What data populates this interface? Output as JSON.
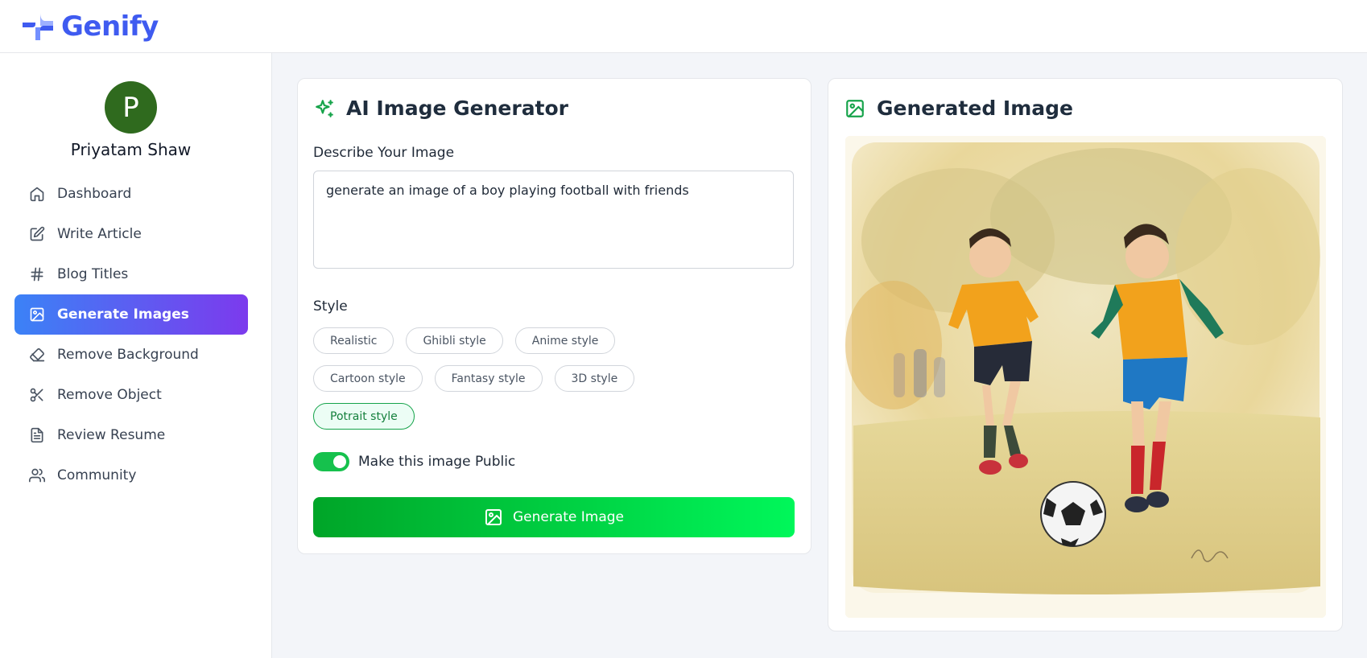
{
  "app": {
    "name": "Genify"
  },
  "user": {
    "initial": "P",
    "name": "Priyatam Shaw"
  },
  "sidebar": {
    "items": [
      {
        "label": "Dashboard",
        "icon": "home-icon",
        "active": false
      },
      {
        "label": "Write Article",
        "icon": "edit-icon",
        "active": false
      },
      {
        "label": "Blog Titles",
        "icon": "hash-icon",
        "active": false
      },
      {
        "label": "Generate Images",
        "icon": "image-icon",
        "active": true
      },
      {
        "label": "Remove Background",
        "icon": "eraser-icon",
        "active": false
      },
      {
        "label": "Remove Object",
        "icon": "scissors-icon",
        "active": false
      },
      {
        "label": "Review Resume",
        "icon": "file-text-icon",
        "active": false
      },
      {
        "label": "Community",
        "icon": "users-icon",
        "active": false
      }
    ]
  },
  "generator": {
    "title": "AI Image Generator",
    "prompt_label": "Describe Your Image",
    "prompt_value": "generate an image of a boy playing football with friends",
    "style_label": "Style",
    "styles": [
      "Realistic",
      "Ghibli style",
      "Anime style",
      "Cartoon style",
      "Fantasy style",
      "3D style",
      "Potrait style"
    ],
    "selected_style": "Potrait style",
    "public_toggle_label": "Make this image Public",
    "public_toggle_on": true,
    "button_label": "Generate Image"
  },
  "output": {
    "title": "Generated Image",
    "image_description": "generated-football-image"
  },
  "colors": {
    "brand": "#3f5bf0",
    "accent_green": "#16c14d",
    "nav_active_start": "#3b82f6",
    "nav_active_end": "#7c3aed"
  }
}
